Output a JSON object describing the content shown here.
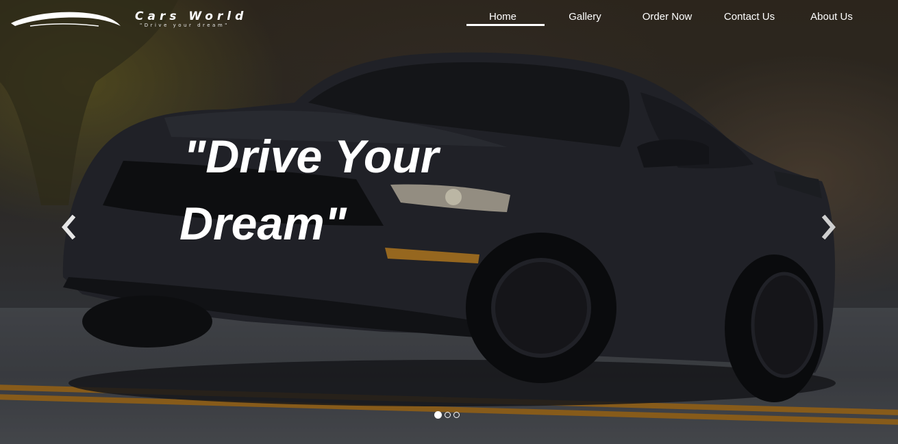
{
  "brand": {
    "name": "Cars World",
    "tagline": "\"Drive your dream\""
  },
  "nav": {
    "items": [
      {
        "label": "Home",
        "active": true
      },
      {
        "label": "Gallery",
        "active": false
      },
      {
        "label": "Order Now",
        "active": false
      },
      {
        "label": "Contact Us",
        "active": false
      },
      {
        "label": "About Us",
        "active": false
      }
    ]
  },
  "hero": {
    "headline_line1": "\"Drive Your",
    "headline_line2": "Dream\"",
    "slides_total": 3,
    "active_slide": 1
  },
  "icons": {
    "prev": "chevron-left-icon",
    "next": "chevron-right-icon"
  },
  "colors": {
    "text": "#ffffff",
    "road_stripe": "#b57a23",
    "car_body": "#2b2d34"
  }
}
